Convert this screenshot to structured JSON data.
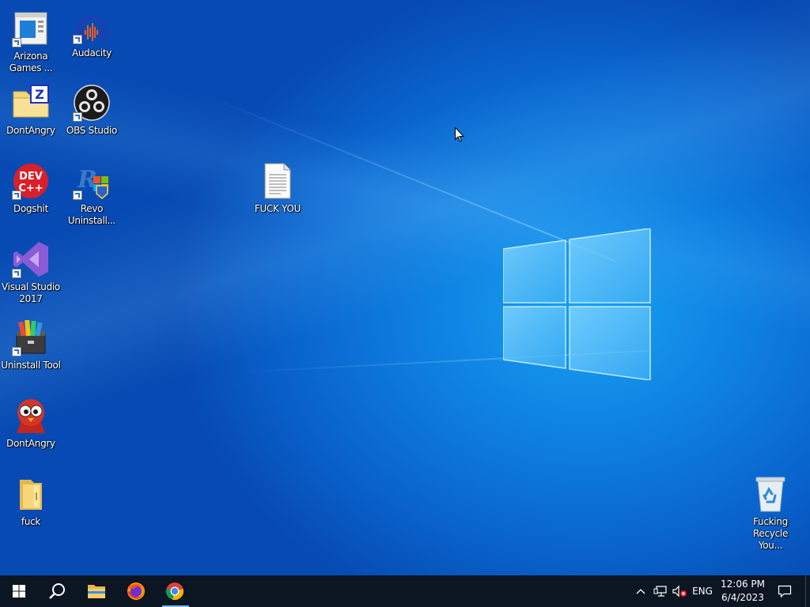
{
  "desktop": {
    "icons": [
      {
        "label": "Arizona Games ...",
        "icon": "web-window-icon"
      },
      {
        "label": "Audacity",
        "icon": "audacity-headphones-icon"
      },
      {
        "label": "DontAngry",
        "icon": "zip-archive-icon"
      },
      {
        "label": "OBS Studio",
        "icon": "obs-icon"
      },
      {
        "label": "Dogshit",
        "icon": "dev-cpp-icon"
      },
      {
        "label": "Revo Uninstall...",
        "icon": "revo-uninstaller-icon"
      },
      {
        "label": "FUCK YOU",
        "icon": "text-file-icon"
      },
      {
        "label": "Visual Studio 2017",
        "icon": "visual-studio-icon"
      },
      {
        "label": "Uninstall Tool",
        "icon": "uninstall-tool-icon"
      },
      {
        "label": "DontAngry",
        "icon": "red-bird-icon"
      },
      {
        "label": "fuck",
        "icon": "folder-icon"
      },
      {
        "label": "Fucking Recycle You...",
        "icon": "recycle-bin-icon"
      }
    ]
  },
  "taskbar": {
    "apps": [
      {
        "name": "start",
        "icon": "windows-start-icon"
      },
      {
        "name": "search",
        "icon": "search-icon"
      },
      {
        "name": "file-explorer",
        "icon": "folder-icon"
      },
      {
        "name": "firefox",
        "icon": "firefox-icon"
      },
      {
        "name": "chrome",
        "icon": "chrome-icon",
        "active": true
      }
    ],
    "tray": {
      "language": "ENG",
      "time": "12:06 PM",
      "date": "6/4/2023"
    }
  },
  "colors": {
    "taskbar_bg": "#0c1522",
    "desktop_accent": "#0f84e3",
    "active_indicator": "#76b9ed"
  }
}
